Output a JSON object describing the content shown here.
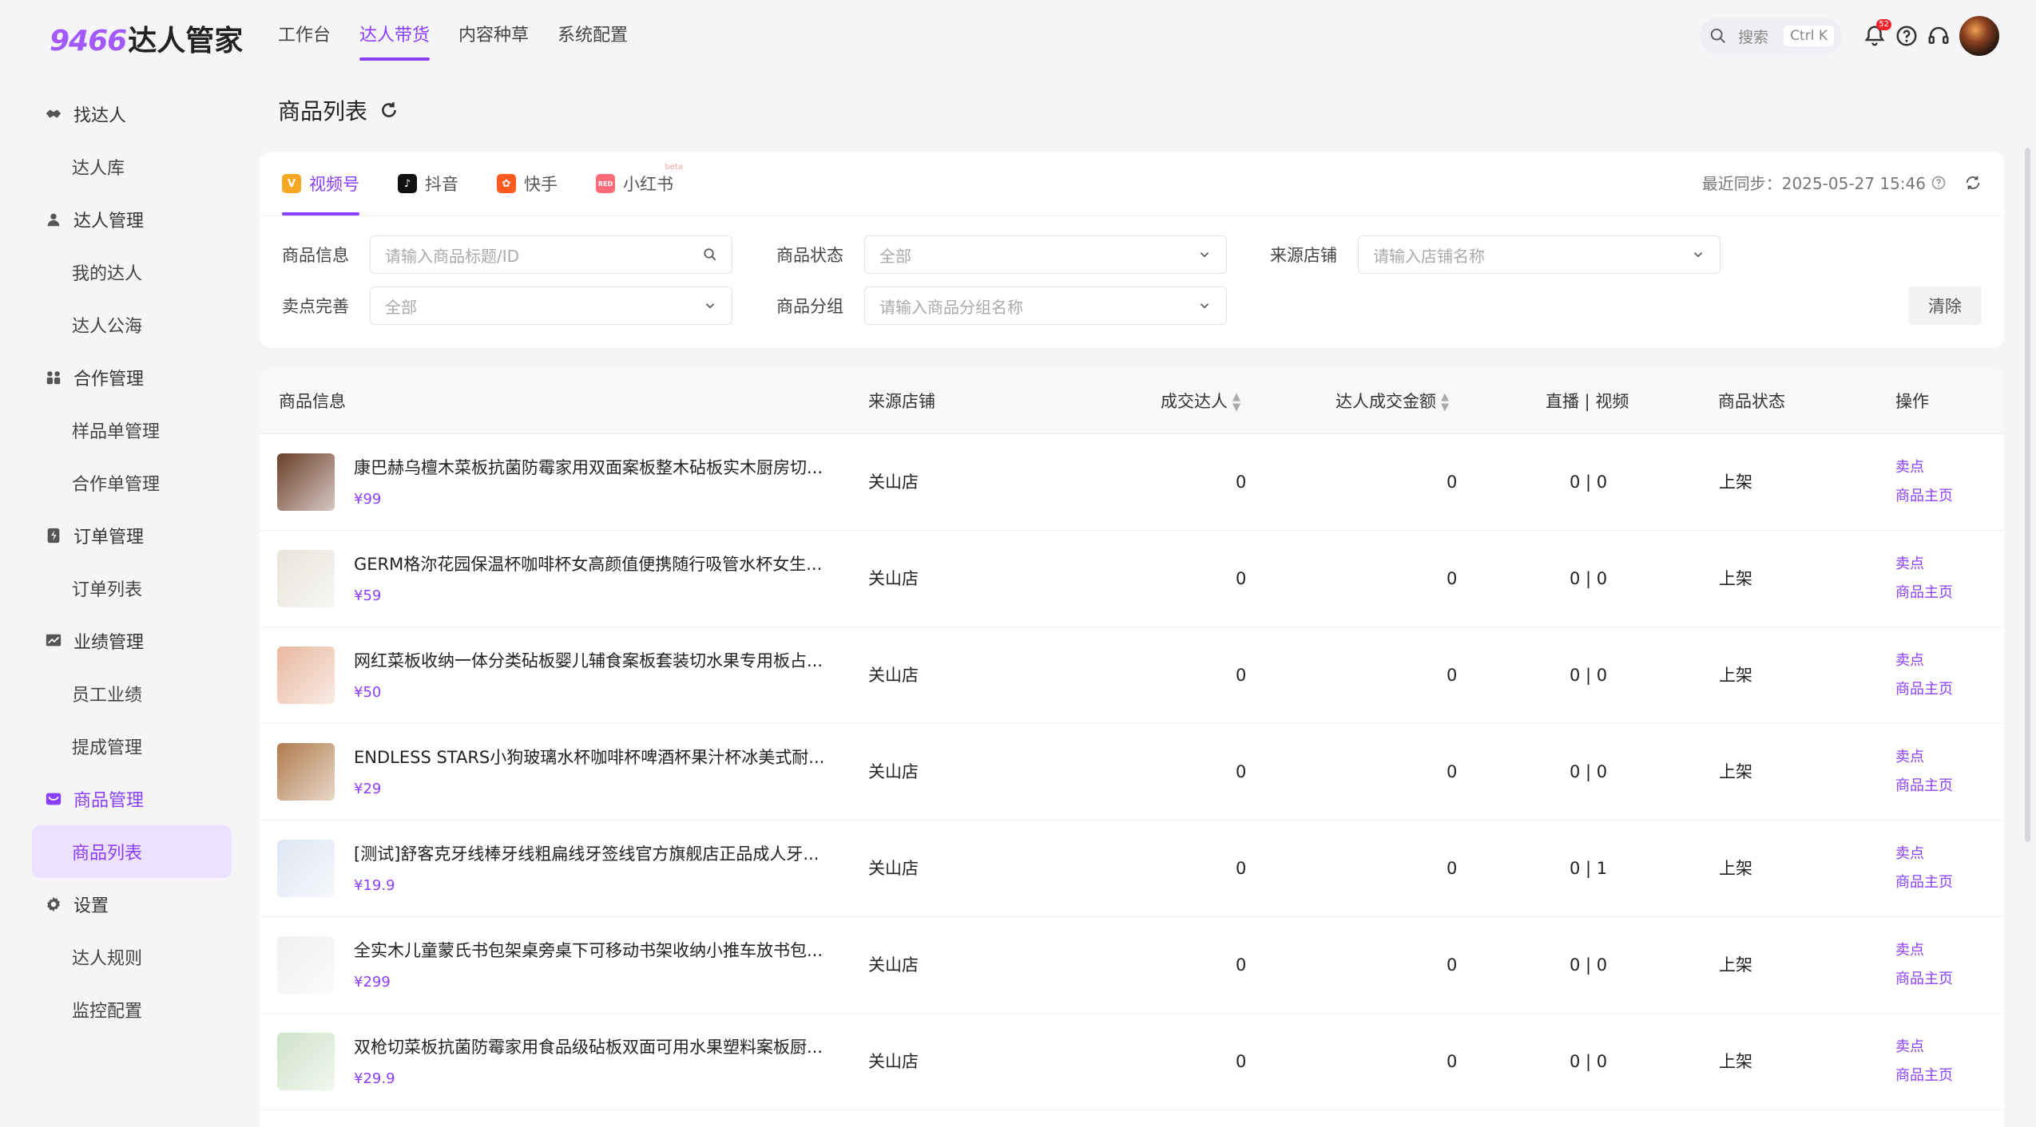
{
  "app": {
    "logo_num": "9466",
    "logo_text": "达人管家"
  },
  "topnav": {
    "items": [
      "工作台",
      "达人带货",
      "内容种草",
      "系统配置"
    ],
    "active_index": 1
  },
  "search": {
    "placeholder": "搜索",
    "shortcut": "Ctrl K"
  },
  "notifications": {
    "count": "52"
  },
  "sidebar": {
    "groups": [
      {
        "label": "找达人",
        "icon": "handshake-icon",
        "children": [
          "达人库"
        ]
      },
      {
        "label": "达人管理",
        "icon": "person-icon",
        "children": [
          "我的达人",
          "达人公海"
        ]
      },
      {
        "label": "合作管理",
        "icon": "group-icon",
        "children": [
          "样品单管理",
          "合作单管理"
        ]
      },
      {
        "label": "订单管理",
        "icon": "order-icon",
        "children": [
          "订单列表"
        ]
      },
      {
        "label": "业绩管理",
        "icon": "chart-icon",
        "children": [
          "员工业绩",
          "提成管理"
        ]
      },
      {
        "label": "商品管理",
        "icon": "bag-icon",
        "children": [
          "商品列表"
        ]
      },
      {
        "label": "设置",
        "icon": "gear-icon",
        "children": [
          "达人规则",
          "监控配置"
        ]
      }
    ]
  },
  "page": {
    "title": "商品列表"
  },
  "platform_tabs": [
    {
      "label": "视频号",
      "color": "#f5a623"
    },
    {
      "label": "抖音",
      "color": "#111111"
    },
    {
      "label": "快手",
      "color": "#ff5a1f"
    },
    {
      "label": "小红书",
      "color": "#ff6b7a",
      "badge": "beta"
    }
  ],
  "sync": {
    "label": "最近同步：2025-05-27 15:46"
  },
  "filters": {
    "product_info": {
      "label": "商品信息",
      "placeholder": "请输入商品标题/ID"
    },
    "product_status": {
      "label": "商品状态",
      "value": "全部"
    },
    "source_shop": {
      "label": "来源店铺",
      "placeholder": "请输入店铺名称"
    },
    "selling_point": {
      "label": "卖点完善",
      "value": "全部"
    },
    "product_group": {
      "label": "商品分组",
      "placeholder": "请输入商品分组名称"
    },
    "clear_label": "清除"
  },
  "table": {
    "headers": {
      "product": "商品信息",
      "shop": "来源店铺",
      "deal_talents": "成交达人",
      "deal_amount": "达人成交金额",
      "live_video": "直播 | 视频",
      "status": "商品状态",
      "ops": "操作"
    },
    "op_labels": {
      "selling_point": "卖点",
      "home": "商品主页"
    },
    "rows": [
      {
        "name": "康巴赫乌檀木菜板抗菌防霉家用双面案板整木砧板实木厨房切...",
        "price": "¥99",
        "shop": "关山店",
        "deal_talents": "0",
        "deal_amount": "0",
        "live_video": "0 | 0",
        "status": "上架",
        "thumb": "#6b3f2a"
      },
      {
        "name": "GERM格沵花园保温杯咖啡杯女高颜值便携随行吸管水杯女生...",
        "price": "¥59",
        "shop": "关山店",
        "deal_talents": "0",
        "deal_amount": "0",
        "live_video": "0 | 0",
        "status": "上架",
        "thumb": "#e8e4da"
      },
      {
        "name": "网红菜板收纳一体分类砧板婴儿辅食案板套装切水果专用板占...",
        "price": "¥50",
        "shop": "关山店",
        "deal_talents": "0",
        "deal_amount": "0",
        "live_video": "0 | 0",
        "status": "上架",
        "thumb": "#e8b8a0"
      },
      {
        "name": "ENDLESS STARS小狗玻璃水杯咖啡杯啤酒杯果汁杯冰美式耐...",
        "price": "¥29",
        "shop": "关山店",
        "deal_talents": "0",
        "deal_amount": "0",
        "live_video": "0 | 0",
        "status": "上架",
        "thumb": "#b07a4a"
      },
      {
        "name": "[测试]舒客克牙线棒牙线粗扁线牙签线官方旗舰店正品成人牙...",
        "price": "¥19.9",
        "shop": "关山店",
        "deal_talents": "0",
        "deal_amount": "0",
        "live_video": "0 | 1",
        "status": "上架",
        "thumb": "#dfe6f2"
      },
      {
        "name": "全实木儿童蒙氏书包架桌旁桌下可移动书架收纳小推车放书包...",
        "price": "¥299",
        "shop": "关山店",
        "deal_talents": "0",
        "deal_amount": "0",
        "live_video": "0 | 0",
        "status": "上架",
        "thumb": "#f2f0ee"
      },
      {
        "name": "双枪切菜板抗菌防霉家用食品级砧板双面可用水果塑料案板厨...",
        "price": "¥29.9",
        "shop": "关山店",
        "deal_talents": "0",
        "deal_amount": "0",
        "live_video": "0 | 0",
        "status": "上架",
        "thumb": "#cfe3c8"
      }
    ]
  }
}
